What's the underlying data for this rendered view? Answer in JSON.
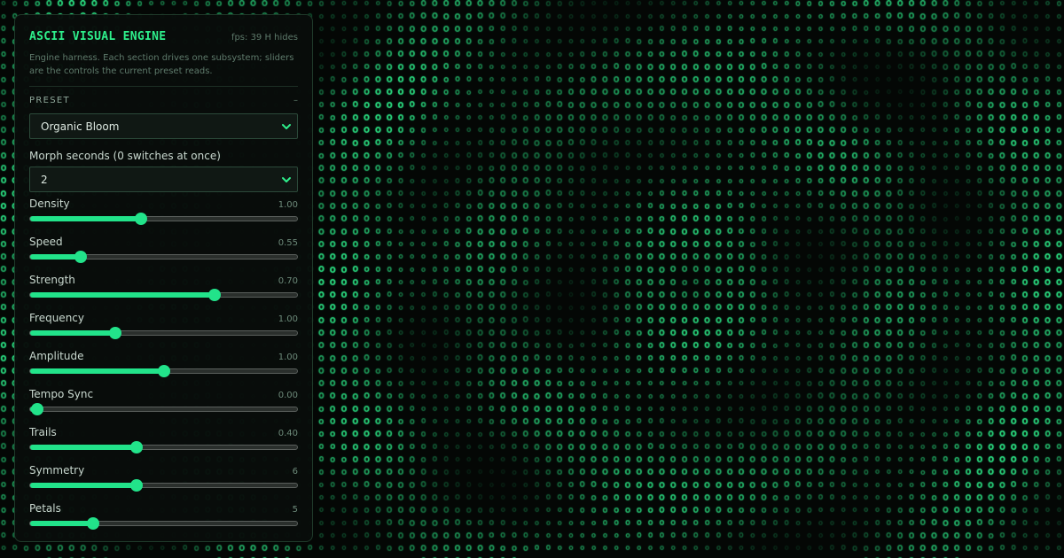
{
  "background": {
    "glyph": "o",
    "color": "#2ef08c"
  },
  "panel": {
    "title": "ASCII VISUAL ENGINE",
    "fps": "fps: 39 H hides",
    "description": "Engine harness. Each section drives one subsystem; sliders are the controls the current preset reads.",
    "section": {
      "title": "PRESET",
      "toggle": "–"
    },
    "preset": {
      "selected": "Organic Bloom"
    },
    "morph": {
      "label": "Morph seconds (0 switches at once)",
      "selected": "2"
    },
    "sliders": [
      {
        "label": "Density",
        "value": "1.00",
        "level": 0.415
      },
      {
        "label": "Speed",
        "value": "0.55",
        "level": 0.188
      },
      {
        "label": "Strength",
        "value": "0.70",
        "level": 0.69
      },
      {
        "label": "Frequency",
        "value": "1.00",
        "level": 0.32
      },
      {
        "label": "Amplitude",
        "value": "1.00",
        "level": 0.5
      },
      {
        "label": "Tempo Sync",
        "value": "0.00",
        "level": 0.025
      },
      {
        "label": "Trails",
        "value": "0.40",
        "level": 0.4
      },
      {
        "label": "Symmetry",
        "value": "6",
        "level": 0.4
      },
      {
        "label": "Petals",
        "value": "5",
        "level": 0.235
      }
    ],
    "accent_color": "#22e38a"
  }
}
